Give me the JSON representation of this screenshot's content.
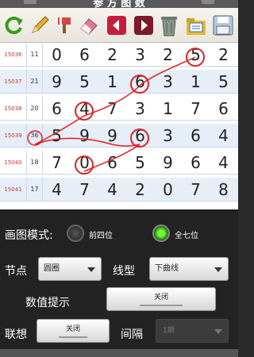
{
  "window": {
    "title": "参 方 图 数"
  },
  "toolbar": {
    "icons": [
      "refresh-icon",
      "pencil-icon",
      "brush-icon",
      "eraser-icon",
      "back-icon",
      "forward-icon",
      "trash-icon",
      "folder-icon",
      "save-icon"
    ]
  },
  "grid": {
    "rows": [
      {
        "issue": "15036",
        "sum": "11",
        "digits": [
          "0",
          "6",
          "2",
          "3",
          "2",
          "5",
          "2"
        ]
      },
      {
        "issue": "15037",
        "sum": "21",
        "digits": [
          "9",
          "5",
          "1",
          "6",
          "3",
          "1",
          "5"
        ]
      },
      {
        "issue": "15038",
        "sum": "20",
        "digits": [
          "6",
          "4",
          "7",
          "3",
          "1",
          "7",
          "6"
        ]
      },
      {
        "issue": "15039",
        "sum": "36",
        "digits": [
          "5",
          "9",
          "9",
          "6",
          "3",
          "6",
          "4"
        ]
      },
      {
        "issue": "15040",
        "sum": "18",
        "digits": [
          "7",
          "0",
          "6",
          "5",
          "9",
          "6",
          "4"
        ]
      },
      {
        "issue": "15041",
        "sum": "17",
        "digits": [
          "4",
          "7",
          "4",
          "2",
          "0",
          "7",
          "8"
        ]
      }
    ],
    "colors": {
      "issue_text": "#c0392b",
      "marker": "#e02020",
      "line": "#e02020",
      "alt_row": "#e6eef8"
    }
  },
  "controls": {
    "draw_mode_label": "画图模式:",
    "mode_option_front4": "前四位",
    "mode_option_all7": "全七位",
    "node_label": "节点",
    "node_value": "圆圈",
    "line_type_label": "线型",
    "line_type_value": "下曲线",
    "value_hint_label": "数值提示",
    "value_hint_toggle": "关闭",
    "assoc_label": "联想",
    "assoc_toggle": "关闭",
    "interval_label": "间隔",
    "interval_value": "1期"
  }
}
